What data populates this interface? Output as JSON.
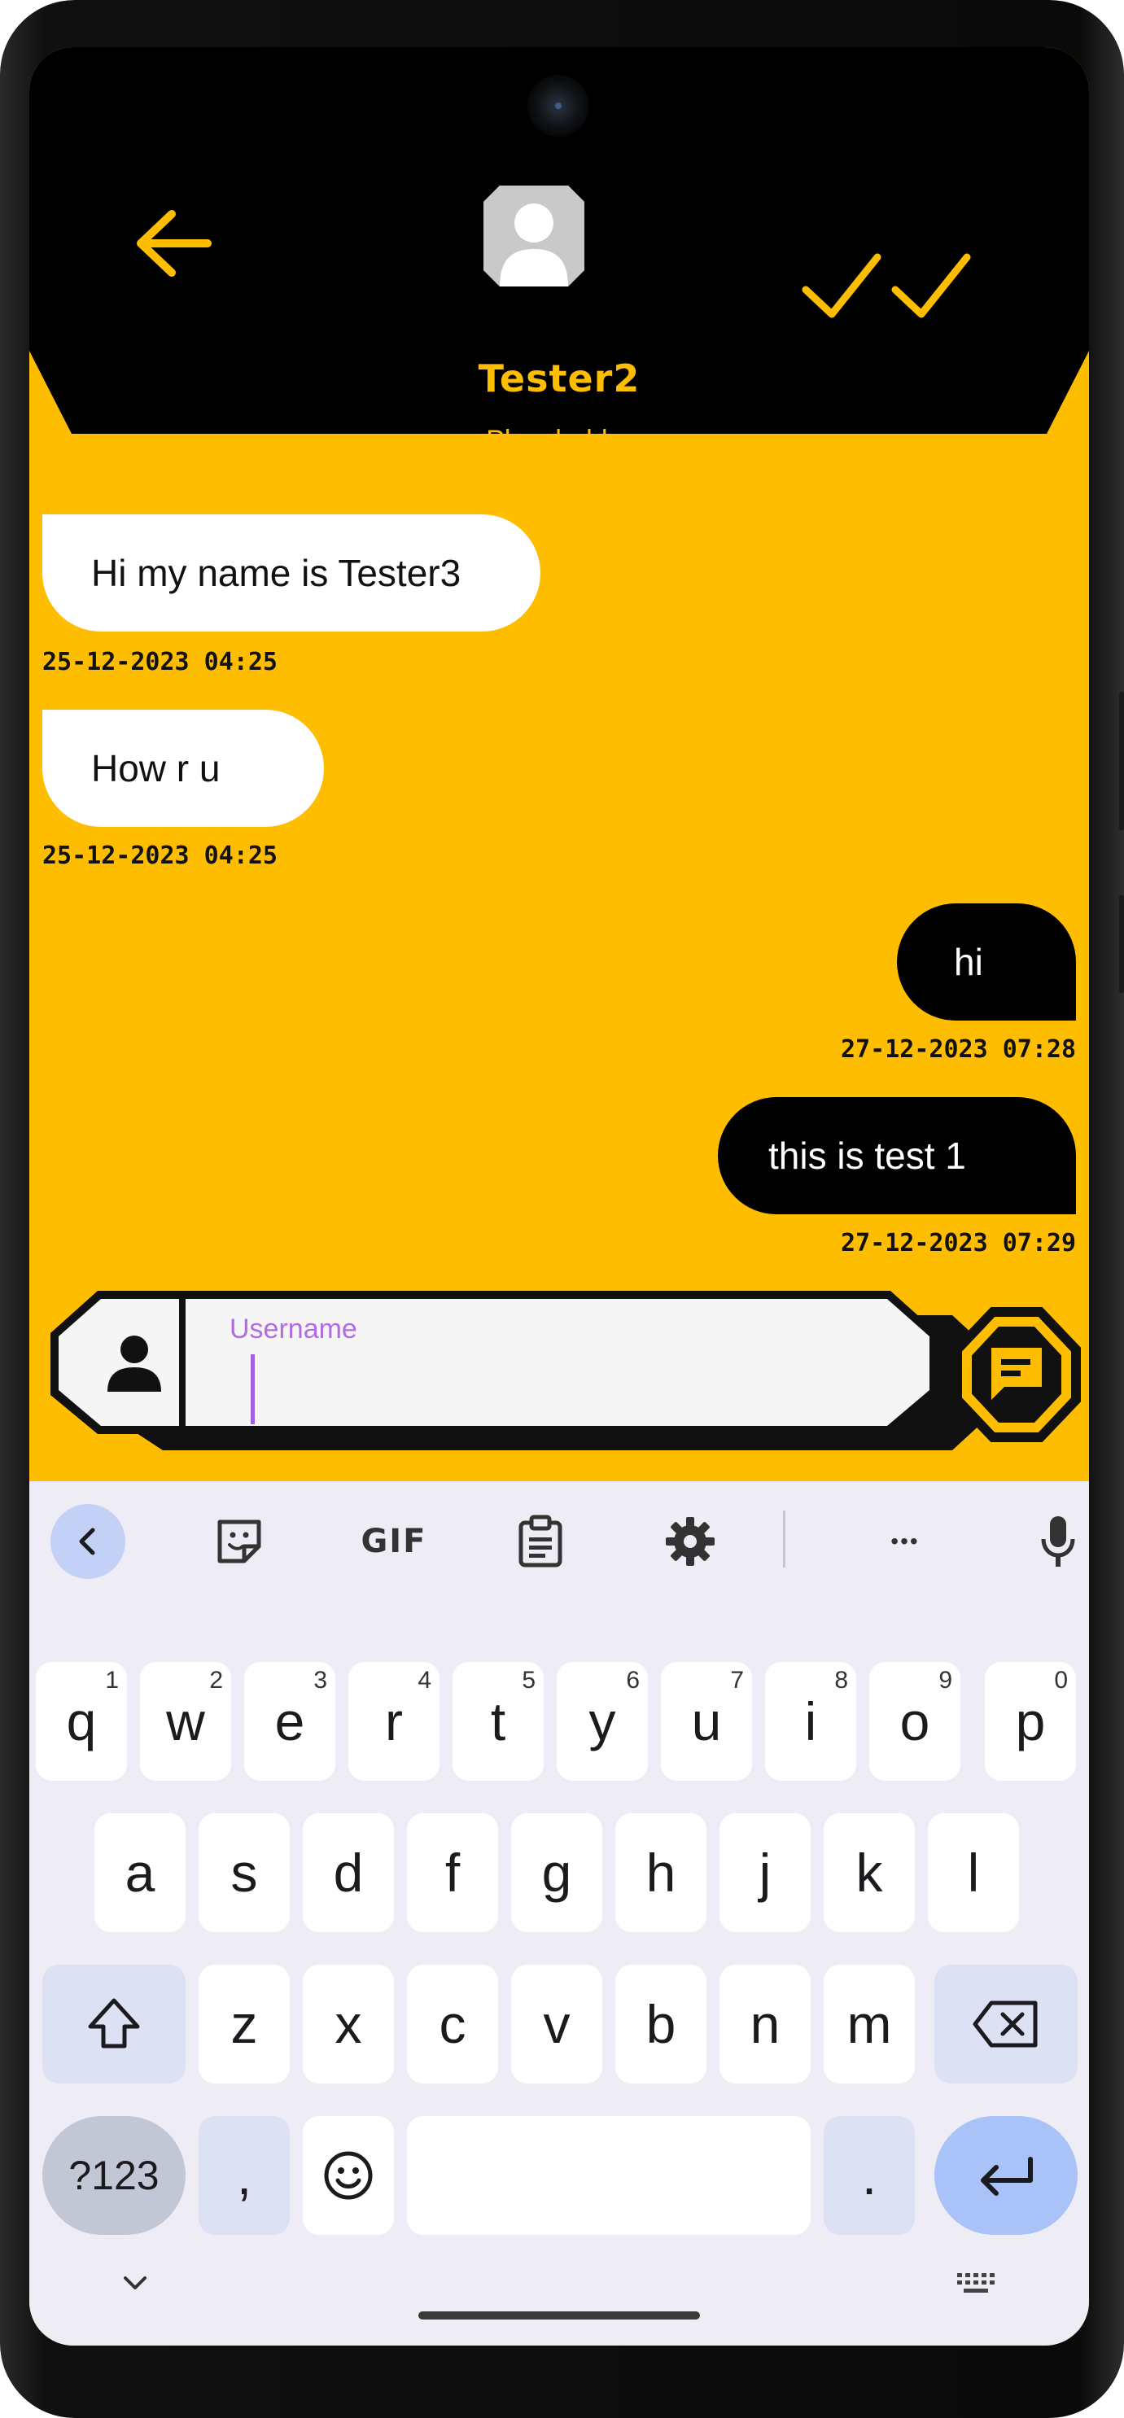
{
  "contact": {
    "name": "Tester2",
    "status": "Placeholder"
  },
  "colors": {
    "accent": "#FFBD00",
    "header": "#000000",
    "incoming_bubble": "#FFFFFF",
    "outgoing_bubble": "#000000",
    "keyboard_bg": "#EEEDF6",
    "field_label": "#B26BE2"
  },
  "icons": {
    "back": "arrow-left-icon",
    "avatar": "avatar-icon",
    "read_receipt": "double-check-icon",
    "person": "person-icon",
    "send": "chat-send-icon"
  },
  "messages": [
    {
      "direction": "in",
      "text": "Hi my name is Tester3",
      "time": "25-12-2023 04:25"
    },
    {
      "direction": "in",
      "text": "How r u",
      "time": "25-12-2023 04:25"
    },
    {
      "direction": "out",
      "text": "hi",
      "time": "27-12-2023 07:28"
    },
    {
      "direction": "out",
      "text": "this is test 1",
      "time": "27-12-2023 07:29"
    }
  ],
  "composer": {
    "label": "Username",
    "value": ""
  },
  "keyboard": {
    "toolbar": [
      "back-icon",
      "sticker-icon",
      "gif-icon",
      "clipboard-icon",
      "settings-icon",
      "more-icon",
      "mic-icon"
    ],
    "gif_label": "GIF",
    "more_label": "•••",
    "row1": [
      {
        "k": "q",
        "hint": "1"
      },
      {
        "k": "w",
        "hint": "2"
      },
      {
        "k": "e",
        "hint": "3"
      },
      {
        "k": "r",
        "hint": "4"
      },
      {
        "k": "t",
        "hint": "5"
      },
      {
        "k": "y",
        "hint": "6"
      },
      {
        "k": "u",
        "hint": "7"
      },
      {
        "k": "i",
        "hint": "8"
      },
      {
        "k": "o",
        "hint": "9"
      },
      {
        "k": "p",
        "hint": "0"
      }
    ],
    "row2": [
      "a",
      "s",
      "d",
      "f",
      "g",
      "h",
      "j",
      "k",
      "l"
    ],
    "row3": [
      "z",
      "x",
      "c",
      "v",
      "b",
      "n",
      "m"
    ],
    "sym_label": "?123",
    "comma": ",",
    "period": ".",
    "emoji": "☺"
  }
}
